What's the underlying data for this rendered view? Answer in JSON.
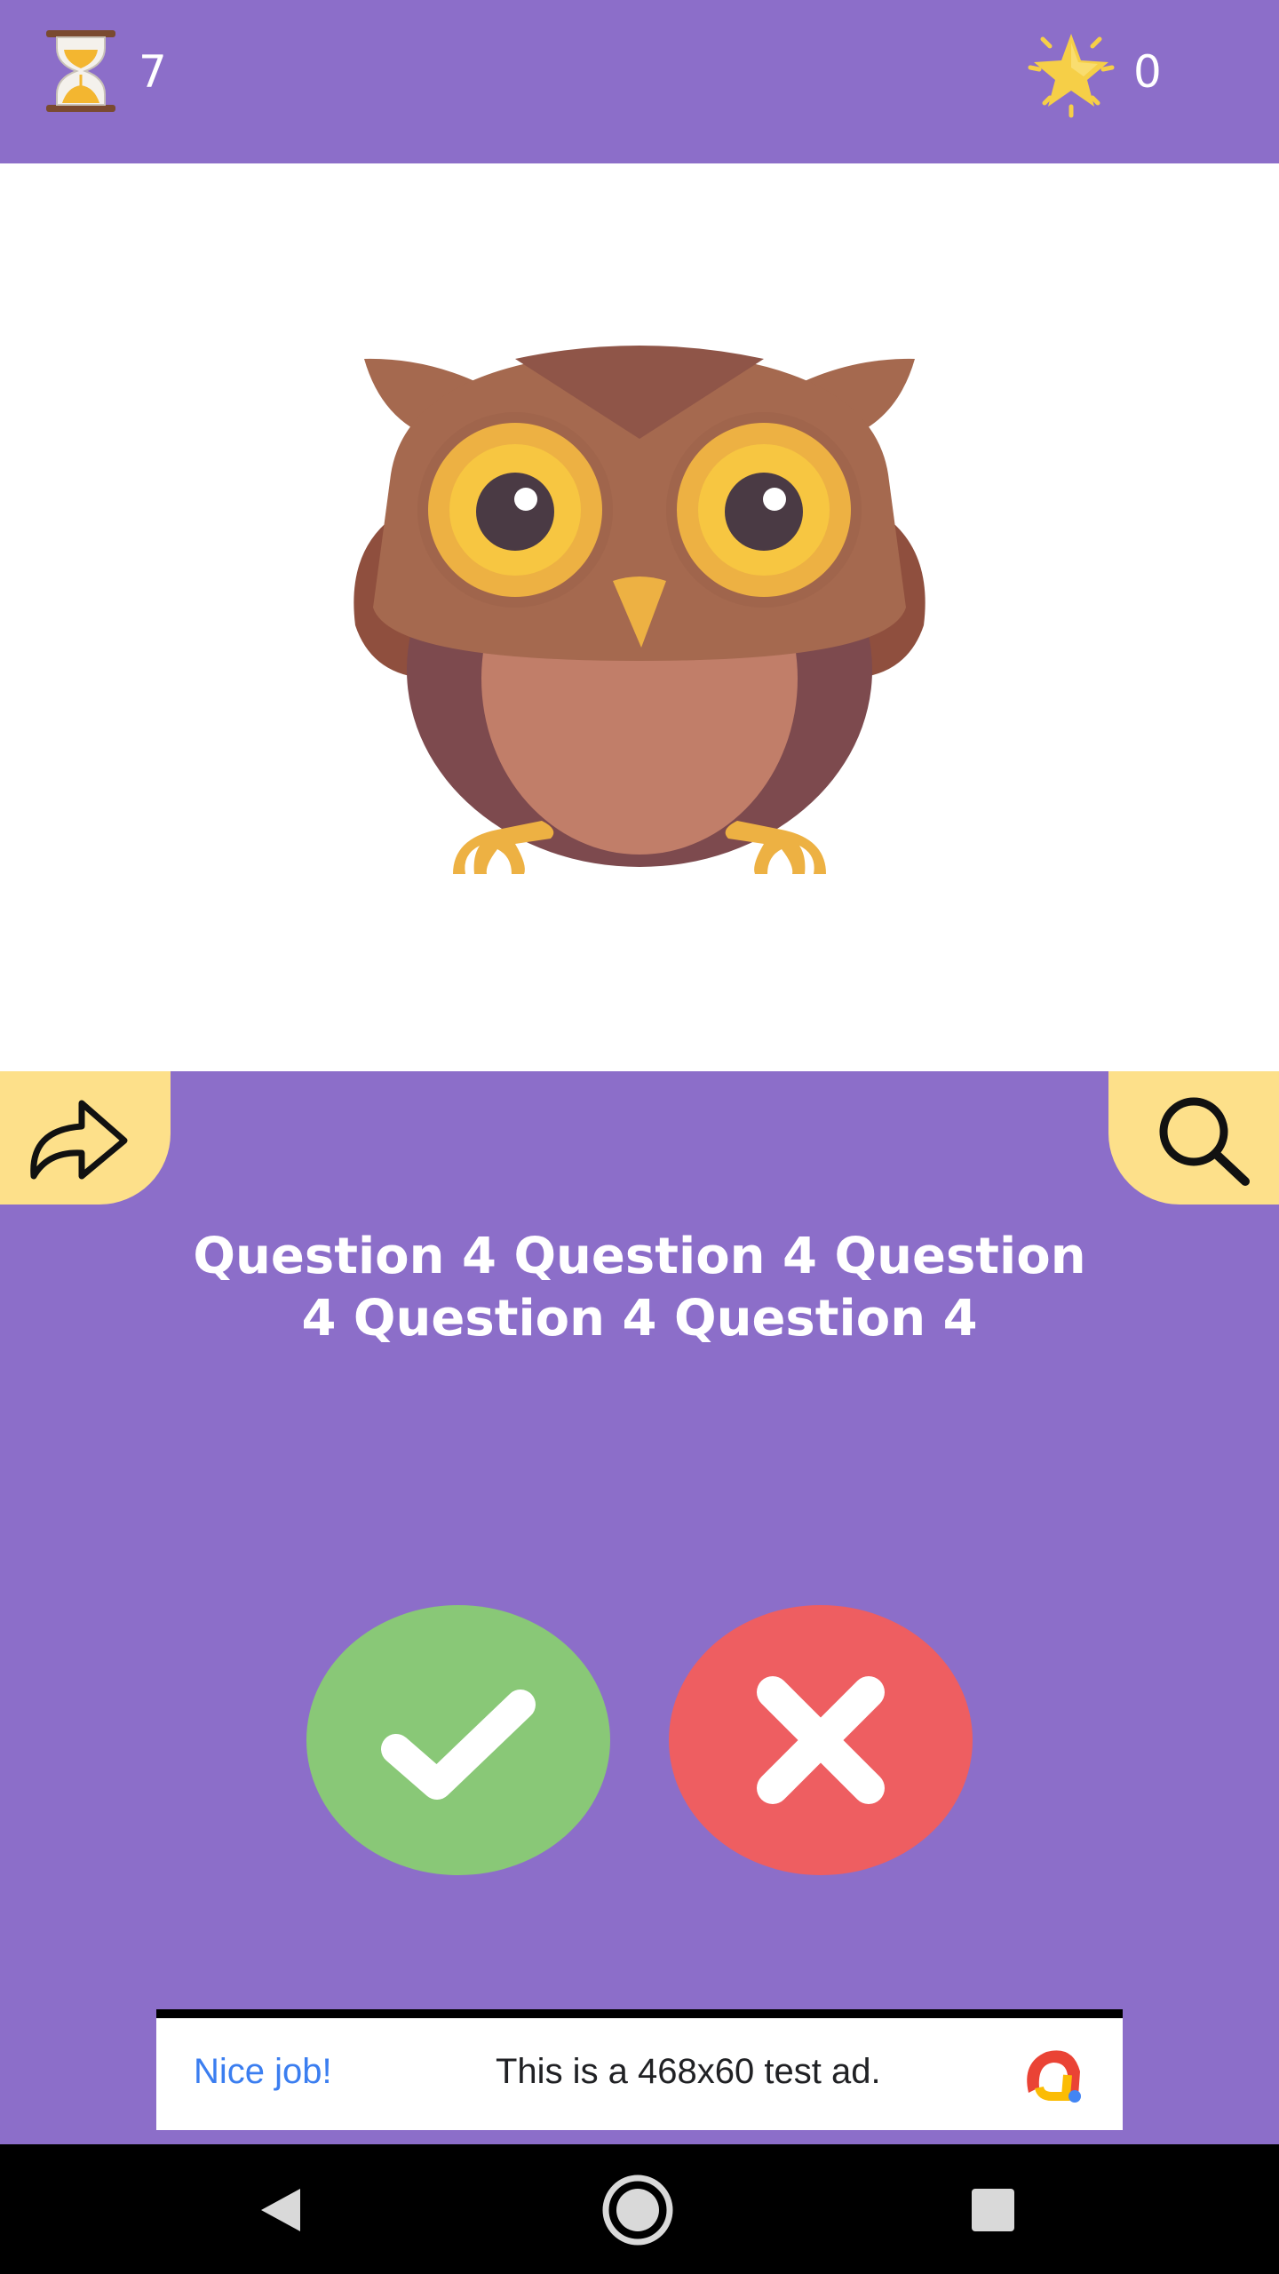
{
  "header": {
    "timer_icon": "hourglass-icon",
    "timer_value": "7",
    "score_icon": "star-icon",
    "score_value": "0"
  },
  "question_image": {
    "icon": "owl-illustration"
  },
  "actions": {
    "share_icon": "share-arrow-icon",
    "search_icon": "search-icon"
  },
  "question": {
    "text": "Question 4 Question 4 Question 4 Question 4 Question 4"
  },
  "answers": {
    "true_icon": "checkmark-icon",
    "false_icon": "cross-icon",
    "true_color": "#89c877",
    "false_color": "#ee5e61"
  },
  "ad": {
    "headline": "Nice job!",
    "body": "This is a 468x60 test ad.",
    "logo_icon": "ad-logo-icon"
  },
  "colors": {
    "background": "#8c6ec9",
    "corner_button": "#fde08a"
  },
  "navigation": {
    "back_icon": "back-triangle-icon",
    "home_icon": "home-circle-icon",
    "recents_icon": "recents-square-icon"
  }
}
